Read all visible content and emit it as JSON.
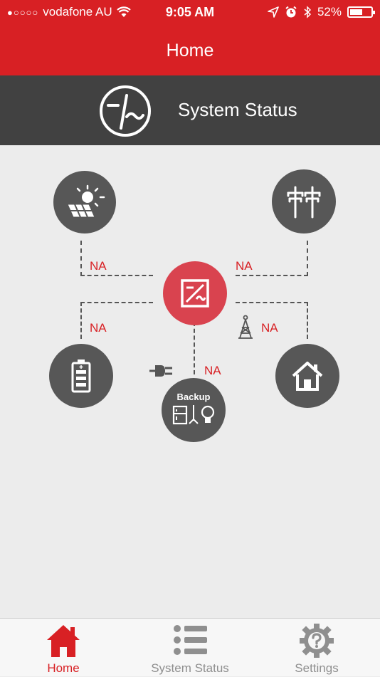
{
  "status_bar": {
    "carrier": "vodafone AU",
    "time": "9:05 AM",
    "battery": "52%",
    "battery_level": 0.52
  },
  "nav": {
    "title": "Home"
  },
  "header": {
    "title": "System Status"
  },
  "diagram": {
    "solar_na": "NA",
    "grid_na": "NA",
    "battery_na": "NA",
    "load_na": "NA",
    "backup_na": "NA",
    "backup_label": "Backup"
  },
  "tabs": [
    {
      "label": "Home",
      "icon": "home-icon",
      "active": true
    },
    {
      "label": "System Status",
      "icon": "list-icon",
      "active": false
    },
    {
      "label": "Settings",
      "icon": "gear-question-icon",
      "active": false
    }
  ],
  "colors": {
    "accent": "#d82024",
    "dark": "#414141",
    "node": "#575757",
    "inverter": "#d9434f"
  }
}
